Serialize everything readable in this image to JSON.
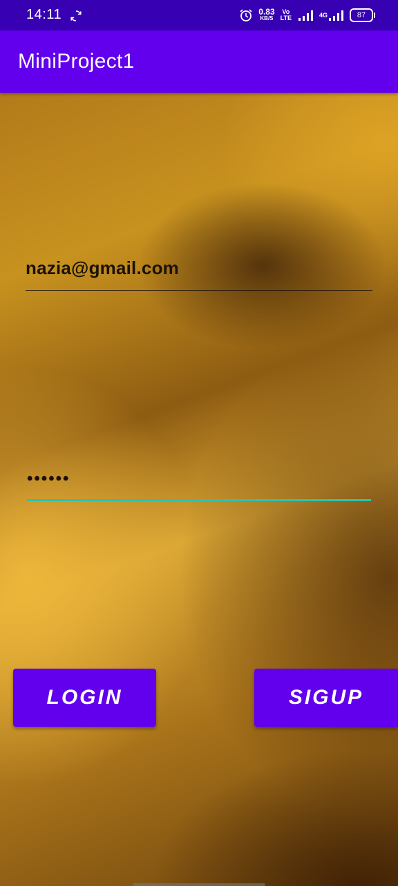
{
  "status_bar": {
    "time": "14:11",
    "net_speed_value": "0.83",
    "net_speed_unit": "KB/S",
    "volte_top": "Vo",
    "volte_bottom": "LTE",
    "network_type": "4G",
    "battery": "87"
  },
  "app_bar": {
    "title": "MiniProject1"
  },
  "form": {
    "email_value": "nazia@gmail.com",
    "password_masked": "••••••"
  },
  "buttons": {
    "login_label": "LOGIN",
    "signup_label": "SIGUP"
  },
  "colors": {
    "status_bar": "#3700b3",
    "primary": "#6200ee",
    "accent_underline": "#2bc4b0"
  }
}
